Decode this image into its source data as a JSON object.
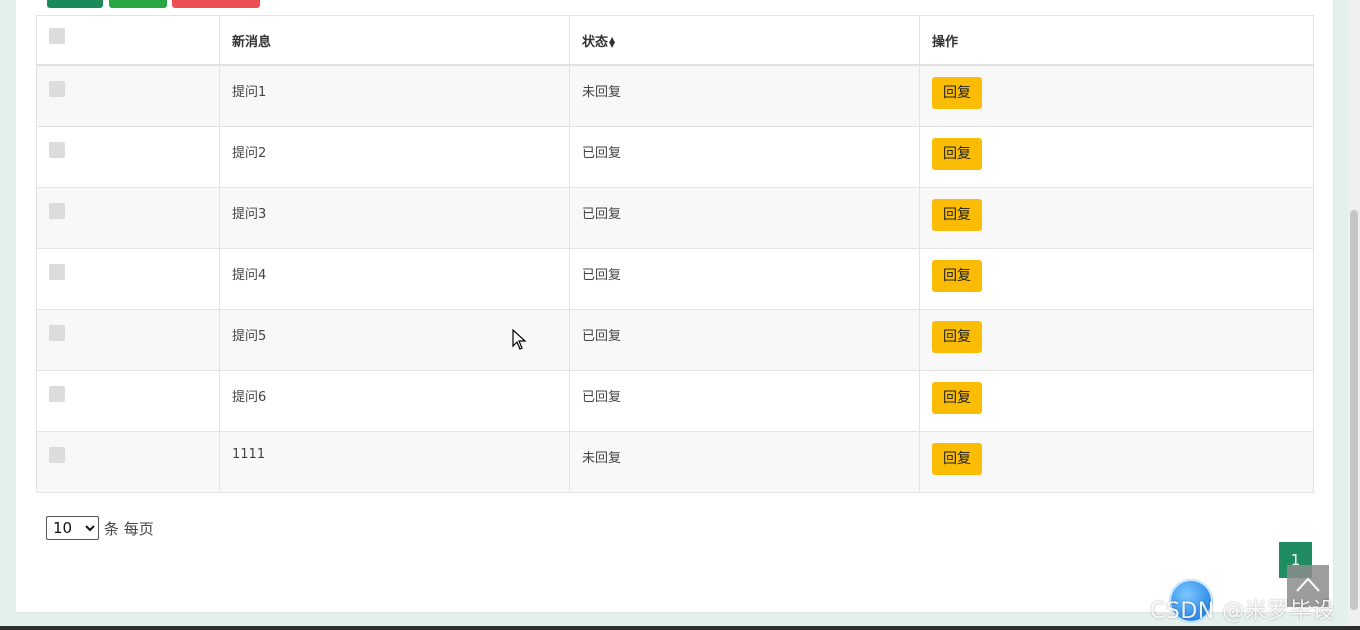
{
  "table": {
    "headers": {
      "new_message": "新消息",
      "status": "状态",
      "action": "操作"
    },
    "rows": [
      {
        "message": "提问1",
        "status": "未回复",
        "action": "回复"
      },
      {
        "message": "提问2",
        "status": "已回复",
        "action": "回复"
      },
      {
        "message": "提问3",
        "status": "已回复",
        "action": "回复"
      },
      {
        "message": "提问4",
        "status": "已回复",
        "action": "回复"
      },
      {
        "message": "提问5",
        "status": "已回复",
        "action": "回复"
      },
      {
        "message": "提问6",
        "status": "已回复",
        "action": "回复"
      },
      {
        "message": "1111",
        "status": "未回复",
        "action": "回复"
      }
    ]
  },
  "pagination": {
    "page_size": "10",
    "page_size_options": [
      "10"
    ],
    "per_page_label": "条 每页",
    "current_page": "1"
  },
  "watermark": "CSDN @米罗毕设",
  "colors": {
    "reply_button": "#fbbc05",
    "page_active": "#1f8c61",
    "top_button_1": "#1a8a5a",
    "top_button_2": "#27a844",
    "top_button_3": "#ef4f54"
  },
  "icons": {
    "sort": "sort-icon",
    "back_to_top": "chevron-up-icon",
    "cursor": "mouse-cursor-icon"
  }
}
